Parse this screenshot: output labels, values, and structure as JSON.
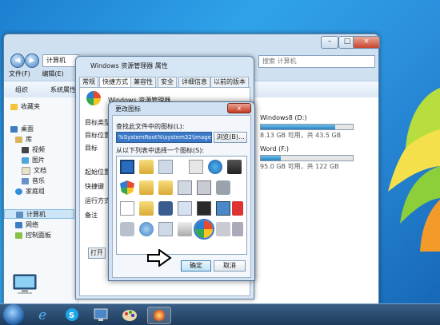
{
  "explorer": {
    "address_crumb": "计算机",
    "search_placeholder": "搜索 计算机",
    "menu": [
      "文件(F)",
      "编辑(E)"
    ],
    "toolbar": [
      "组织",
      "系统属性"
    ],
    "nav": {
      "favorites": "收藏夹",
      "desktop": "桌面",
      "libraries": "库",
      "videos": "视频",
      "pictures": "图片",
      "documents": "文档",
      "music": "音乐",
      "homegroup": "家庭组",
      "computer": "计算机",
      "network": "网络",
      "control_panel": "控制面板"
    },
    "drives": [
      {
        "label": "Windows8 (D:)",
        "free_text": "8.13 GB 可用，共 43.5 GB",
        "used_fraction": 0.81
      },
      {
        "label": "Word (F:)",
        "free_text": "95.0 GB 可用，共 122 GB",
        "used_fraction": 0.22
      }
    ]
  },
  "props": {
    "title": "Windows 资源管理器 属性",
    "tabs": [
      "常规",
      "快捷方式",
      "兼容性",
      "安全",
      "详细信息",
      "以前的版本"
    ],
    "active_tab": "快捷方式",
    "app_name": "Windows 资源管理器",
    "fields": [
      "目标类型",
      "目标位置",
      "目标",
      "起始位置",
      "快捷键",
      "运行方式",
      "备注"
    ],
    "button": "打开"
  },
  "change_icon": {
    "title": "更改图标",
    "lookup_label": "查找此文件中的图标(L):",
    "path_value": "%SystemRoot%\\system32\\imageres.dll",
    "browse_label": "浏览(B)...",
    "select_label": "从以下列表中选择一个图标(S):",
    "ok_label": "确定",
    "cancel_label": "取消",
    "close_label": "x"
  },
  "taskbar": {
    "items": [
      "start-orb",
      "internet-explorer",
      "skype",
      "explorer",
      "paint",
      "windows-media"
    ]
  }
}
